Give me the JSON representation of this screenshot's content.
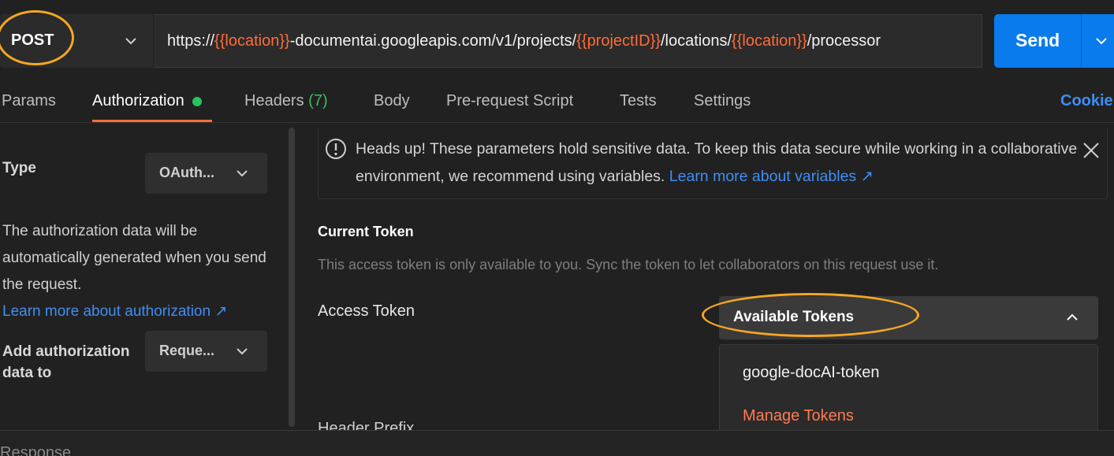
{
  "request": {
    "method": "POST",
    "url_parts": [
      {
        "text": "https://",
        "var": false
      },
      {
        "text": "{{location}}",
        "var": true
      },
      {
        "text": "-documentai.googleapis.com/v1/projects/",
        "var": false
      },
      {
        "text": "{{projectID}}",
        "var": true
      },
      {
        "text": "/locations/",
        "var": false
      },
      {
        "text": "{{location}}",
        "var": true
      },
      {
        "text": "/processor",
        "var": false
      }
    ],
    "send_label": "Send"
  },
  "tabs": {
    "params": "Params",
    "authorization": "Authorization",
    "headers": "Headers",
    "headers_count": "(7)",
    "body": "Body",
    "prerequest": "Pre-request Script",
    "tests": "Tests",
    "settings": "Settings",
    "cookies": "Cookie"
  },
  "auth": {
    "type_label": "Type",
    "type_value": "OAuth...",
    "description": "The authorization data will be automatically generated when you send the request.",
    "learn_link": "Learn more about authorization ↗",
    "add_label": "Add authorization data to",
    "add_value": "Reque..."
  },
  "alert": {
    "text": "Heads up! These parameters hold sensitive data. To keep this data secure while working in a collaborative environment, we recommend using variables.",
    "link": "Learn more about variables ↗"
  },
  "token": {
    "heading": "Current Token",
    "description": "This access token is only available to you. Sync the token to let collaborators on this request use it.",
    "access_label": "Access Token",
    "select_label": "Available Tokens",
    "options": [
      "google-docAI-token",
      "Manage Tokens"
    ],
    "header_prefix": "Header Prefix"
  },
  "response_label": "Response",
  "colors": {
    "accent_orange": "#ff6c37",
    "send_blue": "#097bed",
    "link_blue": "#3f8ef5",
    "status_green": "#22c55e",
    "annotation": "#f5a623"
  }
}
